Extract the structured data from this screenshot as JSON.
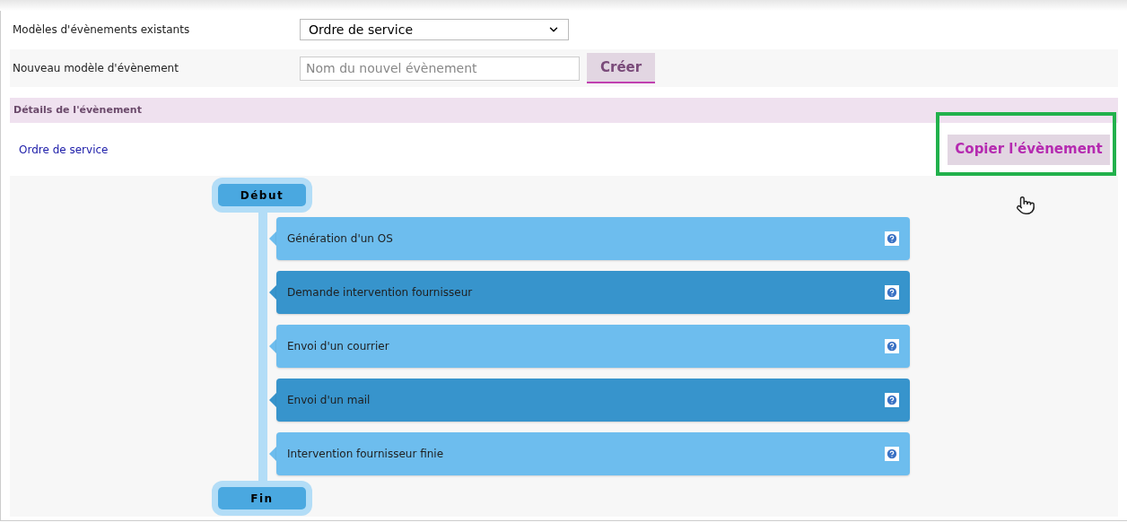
{
  "fields": [
    {
      "kind": "select",
      "label": "Modèles d'évènements existants",
      "value": "Ordre de service"
    },
    {
      "kind": "input",
      "label": "Nouveau modèle d'évènement",
      "placeholder": "Nom du nouvel évènement",
      "button": "Créer"
    }
  ],
  "details": {
    "title": "Détails de l'évènement",
    "event_name": "Ordre de service",
    "copy_button": "Copier l'évènement"
  },
  "flow": {
    "start": "Début",
    "end": "Fin",
    "steps": [
      {
        "label": "Génération d'un OS",
        "color": "#6dbdee"
      },
      {
        "label": "Demande intervention fournisseur",
        "color": "#3794cc"
      },
      {
        "label": "Envoi d'un courrier",
        "color": "#6dbdee"
      },
      {
        "label": "Envoi d'un mail",
        "color": "#3794cc"
      },
      {
        "label": "Intervention fournisseur finie",
        "color": "#6dbdee"
      }
    ]
  }
}
